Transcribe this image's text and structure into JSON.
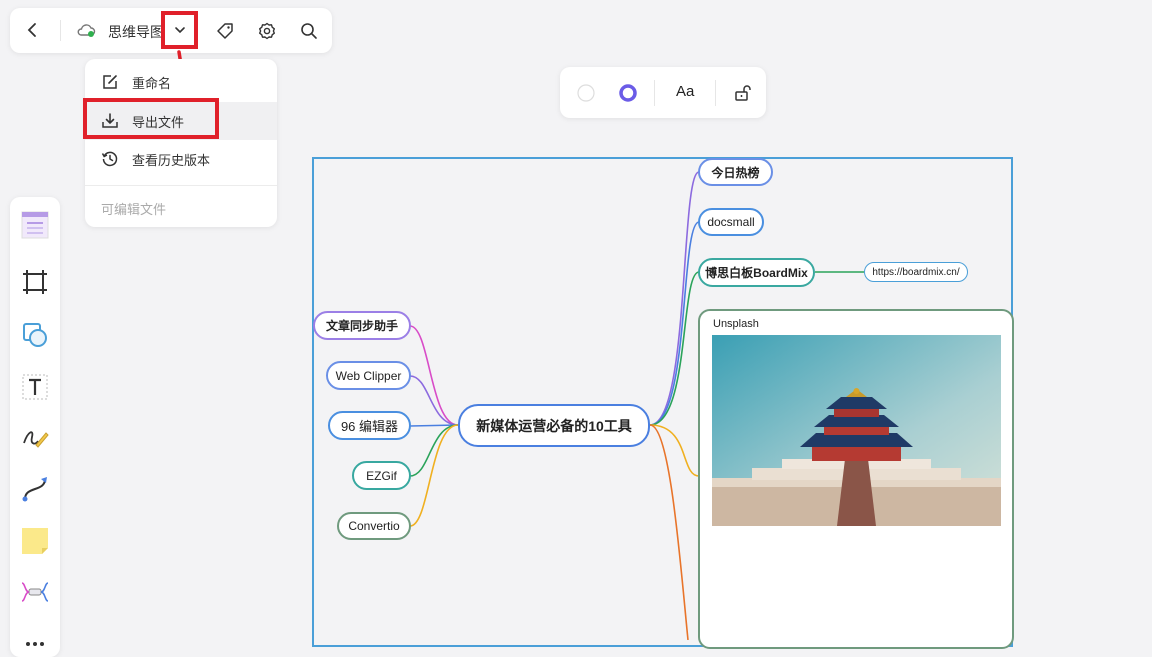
{
  "top_toolbar": {
    "back_icon": "chevron-left-icon",
    "cloud_icon": "cloud-synced-icon",
    "file_title": "思维导图",
    "dropdown_icon": "chevron-down-icon",
    "tag_icon": "tag-icon",
    "settings_icon": "gear-icon",
    "search_icon": "search-icon"
  },
  "dropdown_menu": {
    "items": [
      {
        "label": "重命名",
        "icon": "edit-icon"
      },
      {
        "label": "导出文件",
        "icon": "download-icon"
      },
      {
        "label": "查看历史版本",
        "icon": "history-icon"
      }
    ],
    "footer": "可编辑文件"
  },
  "format_toolbar": {
    "font_label": "Aa",
    "fill_icon": "fill-circle-icon",
    "border_icon": "border-ring-icon",
    "lock_icon": "unlock-icon"
  },
  "left_tools": [
    "template-icon",
    "frame-icon",
    "shape-icon",
    "text-icon",
    "pen-icon",
    "connector-icon",
    "sticky-note-icon",
    "mindmap-icon",
    "more-icon"
  ],
  "mindmap": {
    "root": "新媒体运营必备的10工具",
    "left_nodes": [
      "文章同步助手",
      "Web Clipper",
      "96 编辑器",
      "EZGif",
      "Convertio"
    ],
    "right_nodes": [
      "今日热榜",
      "docsmall",
      "博思白板BoardMix"
    ],
    "link_node": "https://boardmix.cn/",
    "image_card_title": "Unsplash"
  },
  "colors": {
    "highlight": "#e0202a",
    "accent": "#6b5ce7",
    "frame": "#4a9fd8"
  }
}
